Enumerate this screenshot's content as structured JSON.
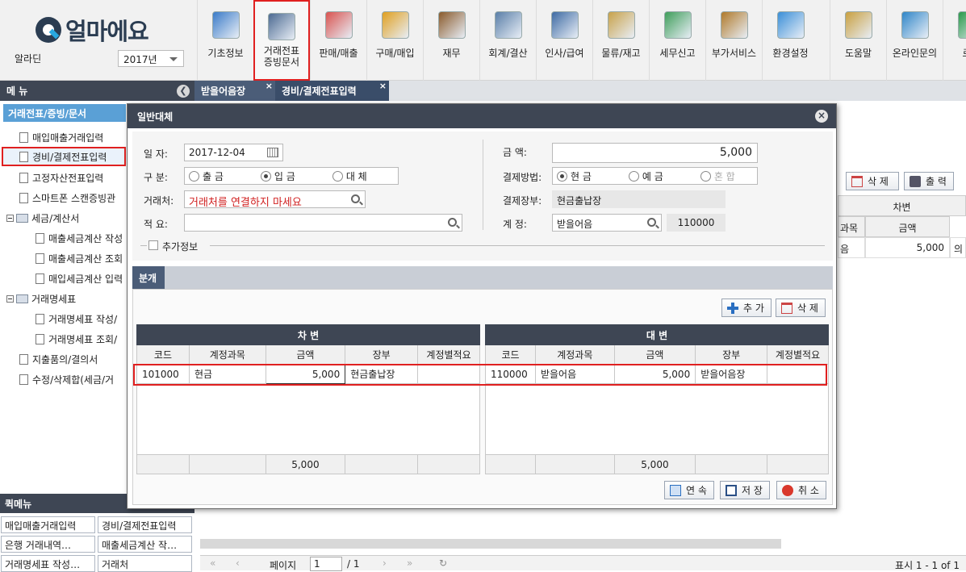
{
  "app": {
    "logo_text": "얼마에요",
    "user": "알라딘",
    "year": "2017년"
  },
  "toolbar": [
    {
      "label": "기초정보",
      "icon": "settings-list-icon"
    },
    {
      "label": "거래전표\n증빙문서",
      "icon": "voucher-icon",
      "selected": true
    },
    {
      "label": "판매/매출",
      "icon": "sales-icon"
    },
    {
      "label": "구매/매입",
      "icon": "purchase-icon"
    },
    {
      "label": "재무",
      "icon": "money-bag-icon"
    },
    {
      "label": "회계/결산",
      "icon": "accounting-icon"
    },
    {
      "label": "인사/급여",
      "icon": "personnel-icon"
    },
    {
      "label": "물류/재고",
      "icon": "logistics-icon"
    },
    {
      "label": "세무신고",
      "icon": "tax-icon"
    },
    {
      "label": "부가서비스",
      "icon": "bank-icon"
    },
    {
      "label": "환경설정",
      "icon": "gear-icon"
    },
    {
      "label": "도움말",
      "icon": "help-book-icon"
    },
    {
      "label": "온라인문의",
      "icon": "online-support-icon"
    },
    {
      "label": "로그",
      "icon": "logout-icon"
    }
  ],
  "menu": {
    "header": "메 뉴",
    "category": "거래전표/증빙/문서",
    "items": [
      {
        "label": "매입매출거래입력",
        "type": "doc",
        "indent": 1
      },
      {
        "label": "경비/결제전표입력",
        "type": "doc",
        "indent": 1,
        "selected": true
      },
      {
        "label": "고정자산전표입력",
        "type": "doc",
        "indent": 1
      },
      {
        "label": "스마트폰 스캔증빙관",
        "type": "doc",
        "indent": 1
      },
      {
        "label": "세금/계산서",
        "type": "folder",
        "indent": 0
      },
      {
        "label": "매출세금계산 작성",
        "type": "doc",
        "indent": 2
      },
      {
        "label": "매출세금계산 조회",
        "type": "doc",
        "indent": 2
      },
      {
        "label": "매입세금계산 입력",
        "type": "doc",
        "indent": 2
      },
      {
        "label": "거래명세표",
        "type": "folder",
        "indent": 0
      },
      {
        "label": "거래명세표 작성/",
        "type": "doc",
        "indent": 2
      },
      {
        "label": "거래명세표 조회/",
        "type": "doc",
        "indent": 2
      },
      {
        "label": "지출품의/결의서",
        "type": "doc",
        "indent": 1
      },
      {
        "label": "수정/삭제합(세금/거",
        "type": "doc",
        "indent": 1
      }
    ]
  },
  "quick_menu": {
    "header": "퀵메뉴",
    "items": [
      "매입매출거래입력",
      "경비/결제전표입력",
      "은행 거래내역…",
      "매출세금계산 작…",
      "거래명세표 작성…",
      "거래처"
    ]
  },
  "tabs": [
    {
      "label": "받을어음장"
    },
    {
      "label": "경비/결제전표입력",
      "active": true
    }
  ],
  "background": {
    "delete_label": "삭 제",
    "print_label": "출 력",
    "header_debit": "차변",
    "col_account": "과목",
    "col_amount": "금액",
    "row_account": "음",
    "row_amount": "5,000",
    "row_extra": "의"
  },
  "modal": {
    "title": "일반대체",
    "date_label": "일 자:",
    "date_value": "2017-12-04",
    "type_label": "구 분:",
    "type_options": [
      {
        "label": "출 금",
        "checked": false
      },
      {
        "label": "입 금",
        "checked": true
      },
      {
        "label": "대 체",
        "checked": false
      }
    ],
    "partner_label": "거래처:",
    "partner_value": "거래처를 연결하지 마세요",
    "summary_label": "적 요:",
    "summary_value": "",
    "amount_label": "금 액:",
    "amount_value": "5,000",
    "pay_method_label": "결제방법:",
    "pay_method_options": [
      {
        "label": "현 금",
        "checked": true
      },
      {
        "label": "예 금",
        "checked": false
      },
      {
        "label": "혼 합",
        "checked": false,
        "disabled": true
      }
    ],
    "pay_book_label": "결제장부:",
    "pay_book_value": "현금출납장",
    "account_label": "계 정:",
    "account_value": "받을어음",
    "account_code": "110000",
    "extra_info_label": "추가정보",
    "split_tab": "분개",
    "add_label": "추 가",
    "delete_label": "삭 제",
    "debit_title": "차 변",
    "credit_title": "대 변",
    "columns": [
      "코드",
      "계정과목",
      "금액",
      "장부",
      "계정별적요"
    ],
    "debit_rows": [
      {
        "code": "101000",
        "account": "현금",
        "amount": "5,000",
        "book": "현금출납장",
        "memo": ""
      }
    ],
    "credit_rows": [
      {
        "code": "110000",
        "account": "받을어음",
        "amount": "5,000",
        "book": "받을어음장",
        "memo": ""
      }
    ],
    "debit_total": "5,000",
    "credit_total": "5,000",
    "continue_label": "연 속",
    "save_label": "저 장",
    "cancel_label": "취 소"
  },
  "pager": {
    "page_label": "페이지",
    "page_value": "1",
    "page_total": "/ 1",
    "display": "표시 1 - 1 of 1"
  },
  "colors": {
    "dark": "#3e4654",
    "accent": "#5aa0d6",
    "highlight": "#e02020"
  }
}
